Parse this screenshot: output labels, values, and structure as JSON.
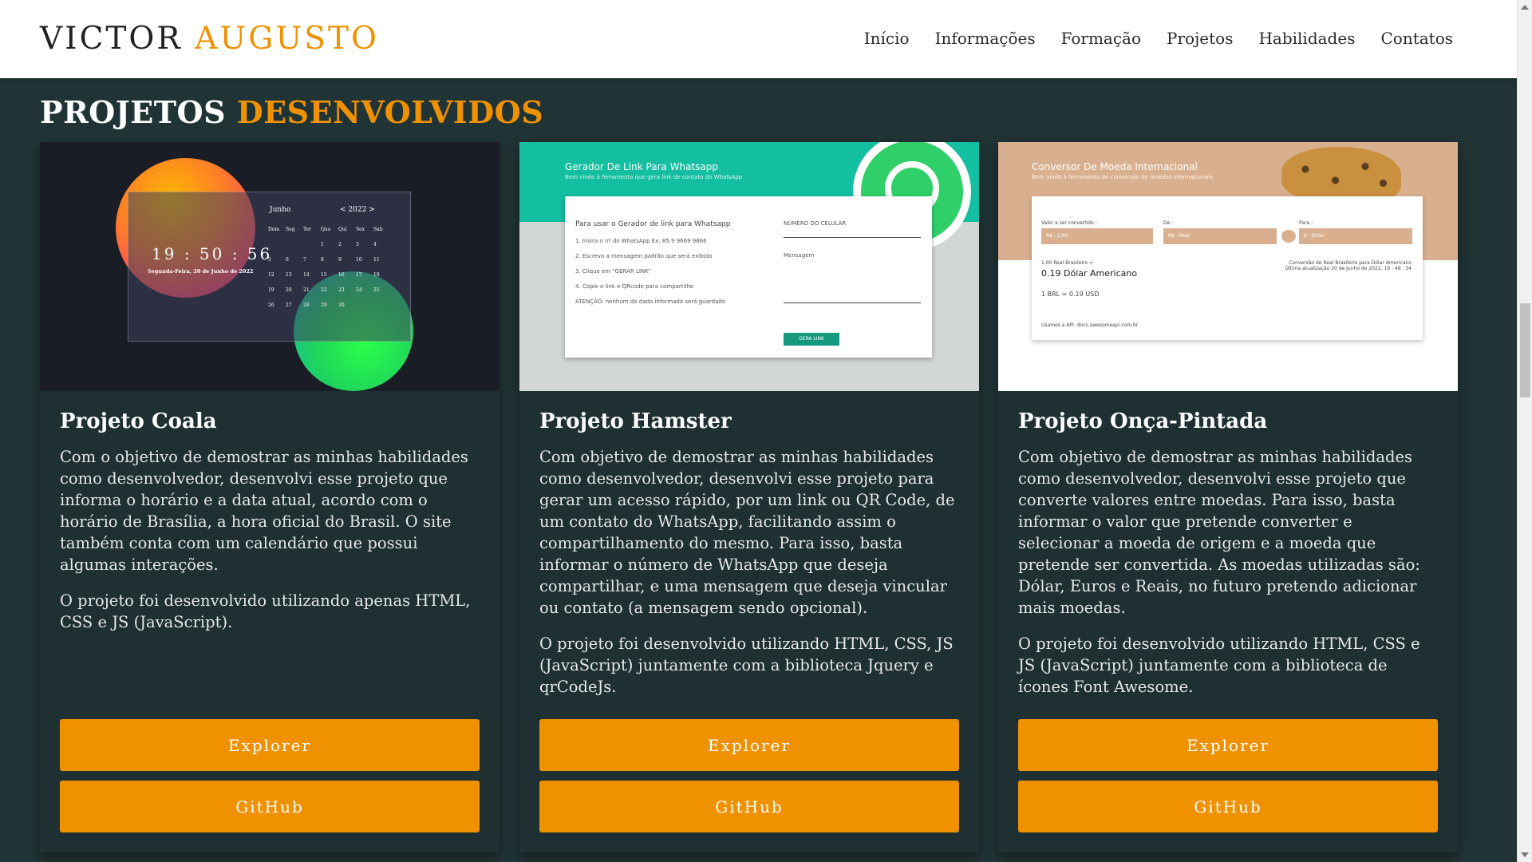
{
  "header": {
    "logo_first": "VICTOR",
    "logo_second": "AUGUSTO",
    "nav": [
      "Início",
      "Informações",
      "Formação",
      "Projetos",
      "Habilidades",
      "Contatos"
    ]
  },
  "section": {
    "title_first": "PROJETOS",
    "title_second": "DESENVOLVIDOS"
  },
  "colors": {
    "accent": "#f09100",
    "background": "#213435",
    "card": "#1f3032"
  },
  "projects": [
    {
      "title": "Projeto Coala",
      "paragraph1": "Com o objetivo de demostrar as minhas habilidades como desenvolvedor, desenvolvi esse projeto que informa o horário e a data atual, acordo com o horário de Brasília, a hora oficial do Brasil. O site também conta com um calendário que possui algumas interações.",
      "paragraph2": "O projeto foi desenvolvido utilizando apenas HTML, CSS e JS (JavaScript).",
      "explorer_label": "Explorer",
      "github_label": "GitHub",
      "preview": {
        "clock": "19 : 50 : 56",
        "date": "Segunda-Feira, 20 de Junho de 2022",
        "month": "Junho",
        "year": "<   2022   >",
        "weekdays": [
          "Dom",
          "Seg",
          "Ter",
          "Qua",
          "Qui",
          "Sex",
          "Sab"
        ],
        "days": [
          "",
          "",
          "",
          "1",
          "2",
          "3",
          "4",
          "5",
          "6",
          "7",
          "8",
          "9",
          "10",
          "11",
          "12",
          "13",
          "14",
          "15",
          "16",
          "17",
          "18",
          "19",
          "20",
          "21",
          "22",
          "23",
          "24",
          "25",
          "26",
          "27",
          "28",
          "29",
          "30",
          "",
          ""
        ]
      }
    },
    {
      "title": "Projeto Hamster",
      "paragraph1": "Com objetivo de demostrar as minhas habilidades como desenvolvedor, desenvolvi esse projeto para gerar um acesso rápido, por um link ou QR Code, de um contato do WhatsApp, facilitando assim o compartilhamento do mesmo. Para isso, basta informar o número de WhatsApp que deseja compartilhar, e uma mensagem que deseja vincular ou contato (a mensagem sendo opcional).",
      "paragraph2": "O projeto foi desenvolvido utilizando HTML, CSS, JS (JavaScript) juntamente com a biblioteca Jquery e qrCodeJs.",
      "explorer_label": "Explorer",
      "github_label": "GitHub",
      "preview": {
        "title": "Gerador De Link Para Whatsapp",
        "subtitle": "Bem vindo à ferramenta que gera link de contato do WhatsApp",
        "heading": "Para usar o Gerador de link para Whatsapp",
        "steps": [
          "1. Insira o nº do WhatsApp Ex: 85 9 9669 9866",
          "2. Escreva a mensagem padrão que será exibida",
          "3. Clique em \"GERAR LINK\"",
          "4. Copie o link e QRcode para compartilhe",
          "ATENÇÃO: nenhum do dado informado será guardado"
        ],
        "phone_label": "NÚMERO DO CELULAR",
        "message_label": "Mensagem",
        "button": "GERA LINK"
      }
    },
    {
      "title": "Projeto Onça-Pintada",
      "paragraph1": "Com objetivo de demostrar as minhas habilidades como desenvolvedor, desenvolvi esse projeto que converte valores entre moedas. Para isso, basta informar o valor que pretende converter e selecionar a moeda de origem e a moeda que pretende ser convertida. As moedas utilizadas são: Dólar, Euros e Reais, no futuro pretendo adicionar mais moedas.",
      "paragraph2": "O projeto foi desenvolvido utilizando HTML, CSS e JS (JavaScript) juntamente com a biblioteca de ícones Font Awesome.",
      "explorer_label": "Explorer",
      "github_label": "GitHub",
      "preview": {
        "title": "Conversor De Moeda Internacional",
        "subtitle": "Bem vindo à ferramenta de conversão de moedas internacionais",
        "value_label": "Valor a ser convertido :",
        "from_label": "De :",
        "to_label": "Para :",
        "value": "R$ : 1,00",
        "from": "R$ - Real",
        "to": "$ - Dólar",
        "result_small": "1,00 Real Brasileiro =",
        "result_big": "0.19 Dólar Americano",
        "rate": "1 BRL = 0.19 USD",
        "conversion_note": "Conversão de Real Brasileiro para Dólar Americano",
        "updated": "Última atualização 20 de Junho de 2022, 19 : 49 : 34",
        "api": "Usamos a API: docs.awesomeapi.com.br"
      }
    }
  ]
}
